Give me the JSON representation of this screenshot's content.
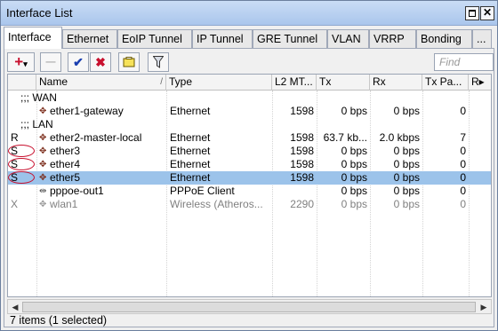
{
  "window": {
    "title": "Interface List"
  },
  "tabs": [
    "Interface",
    "Ethernet",
    "EoIP Tunnel",
    "IP Tunnel",
    "GRE Tunnel",
    "VLAN",
    "VRRP",
    "Bonding",
    "..."
  ],
  "toolbar": {
    "add_glyph": "+",
    "add_dropdown_glyph": "▾",
    "remove_glyph": "—",
    "enable_glyph": "✔",
    "disable_glyph": "✖",
    "find_placeholder": "Find"
  },
  "columns": [
    "",
    "Name",
    "Type",
    "L2 MT...",
    "Tx",
    "Rx",
    "Tx Pa...",
    "R▸"
  ],
  "groups": {
    "wan": ";;; WAN",
    "lan": ";;; LAN"
  },
  "rows": [
    {
      "flag": "",
      "name": "ether1-gateway",
      "type": "Ethernet",
      "mtu": "1598",
      "tx": "0 bps",
      "rx": "0 bps",
      "txp": "0"
    },
    {
      "flag": "R",
      "name": "ether2-master-local",
      "type": "Ethernet",
      "mtu": "1598",
      "tx": "63.7 kb...",
      "rx": "2.0 kbps",
      "txp": "7"
    },
    {
      "flag": "S",
      "name": "ether3",
      "type": "Ethernet",
      "mtu": "1598",
      "tx": "0 bps",
      "rx": "0 bps",
      "txp": "0"
    },
    {
      "flag": "S",
      "name": "ether4",
      "type": "Ethernet",
      "mtu": "1598",
      "tx": "0 bps",
      "rx": "0 bps",
      "txp": "0"
    },
    {
      "flag": "S",
      "name": "ether5",
      "type": "Ethernet",
      "mtu": "1598",
      "tx": "0 bps",
      "rx": "0 bps",
      "txp": "0"
    },
    {
      "flag": "",
      "name": "pppoe-out1",
      "type": "PPPoE Client",
      "mtu": "",
      "tx": "0 bps",
      "rx": "0 bps",
      "txp": "0"
    },
    {
      "flag": "X",
      "name": "wlan1",
      "type": "Wireless (Atheros...",
      "mtu": "2290",
      "tx": "0 bps",
      "rx": "0 bps",
      "txp": "0"
    }
  ],
  "status": "7 items (1 selected)",
  "colors": {
    "selection": "#9cc3ea",
    "annotation_ring": "#c8102e",
    "titlebar": "#b7cff0"
  }
}
